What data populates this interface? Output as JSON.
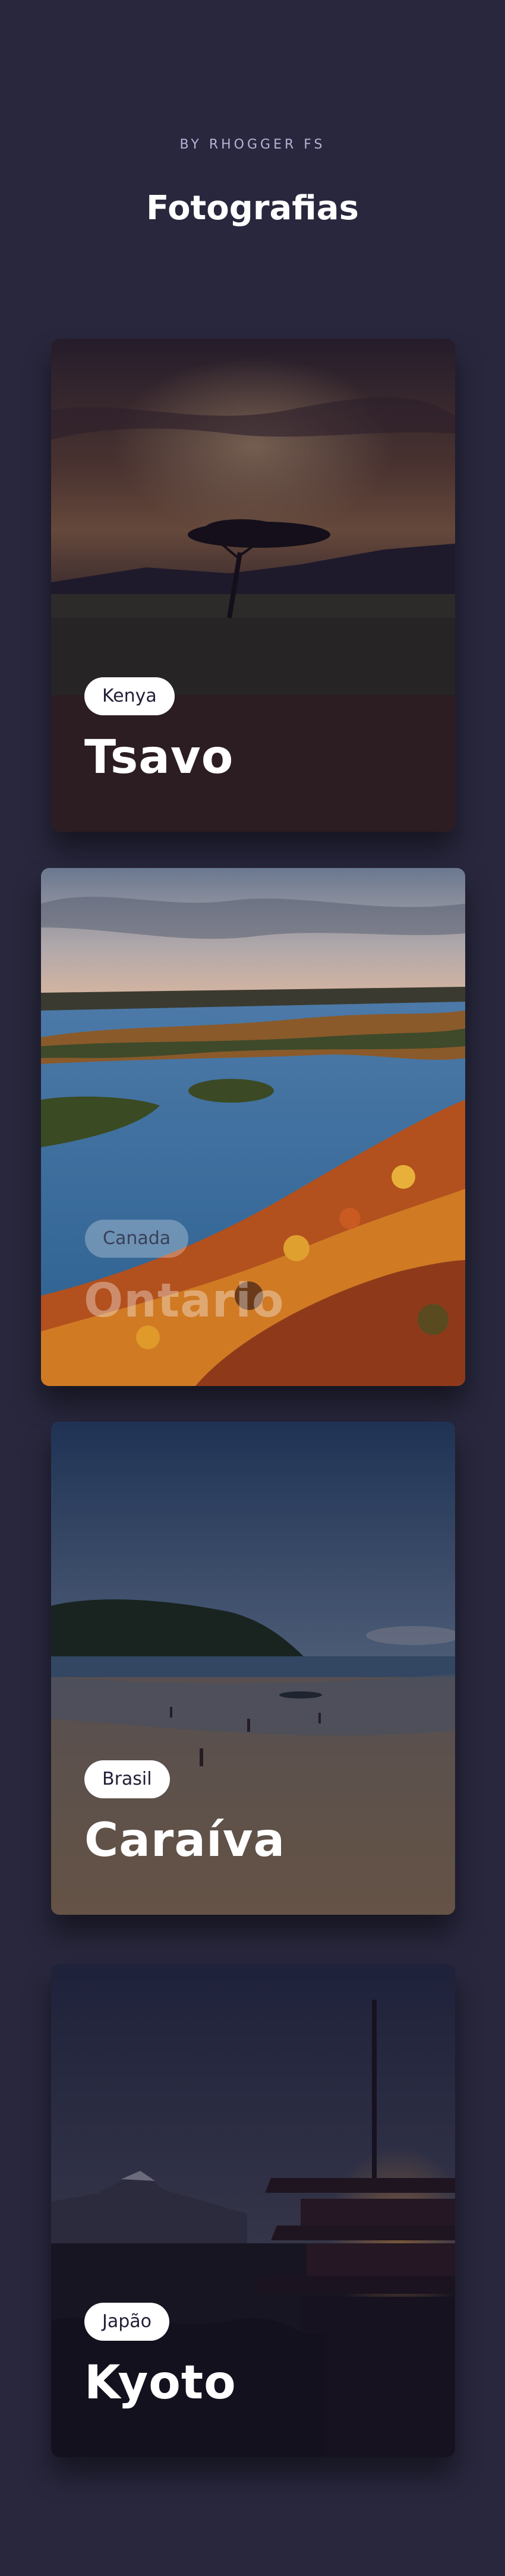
{
  "header": {
    "byline": "BY RHOGGER FS",
    "title": "Fotografias"
  },
  "cards": [
    {
      "country": "Kenya",
      "place": "Tsavo",
      "scene": "savanna-sunset-icon"
    },
    {
      "country": "Canada",
      "place": "Ontario",
      "scene": "lake-autumn-forest-icon"
    },
    {
      "country": "Brasil",
      "place": "Caraíva",
      "scene": "beach-icon"
    },
    {
      "country": "Japão",
      "place": "Kyoto",
      "scene": "pagoda-mountain-icon"
    }
  ]
}
